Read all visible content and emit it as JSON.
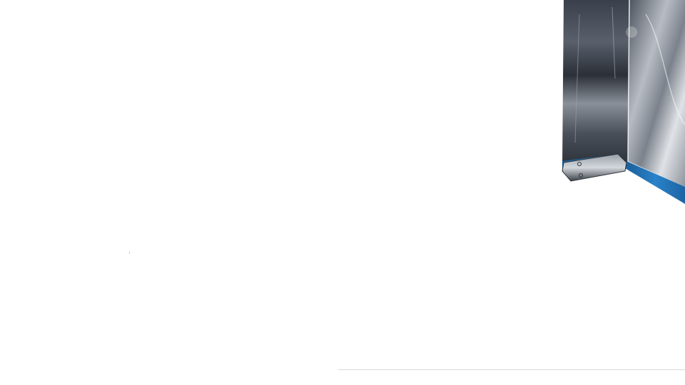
{
  "scene": {
    "subject": "stainless-steel-panel-with-blue-edge",
    "colors": {
      "background": "#ffffff",
      "steel_dark": "#2e3440",
      "steel_mid": "#6b7280",
      "steel_light": "#c9ced6",
      "blue_edge": "#1f6fb2",
      "divider": "#d9d9d9"
    }
  }
}
